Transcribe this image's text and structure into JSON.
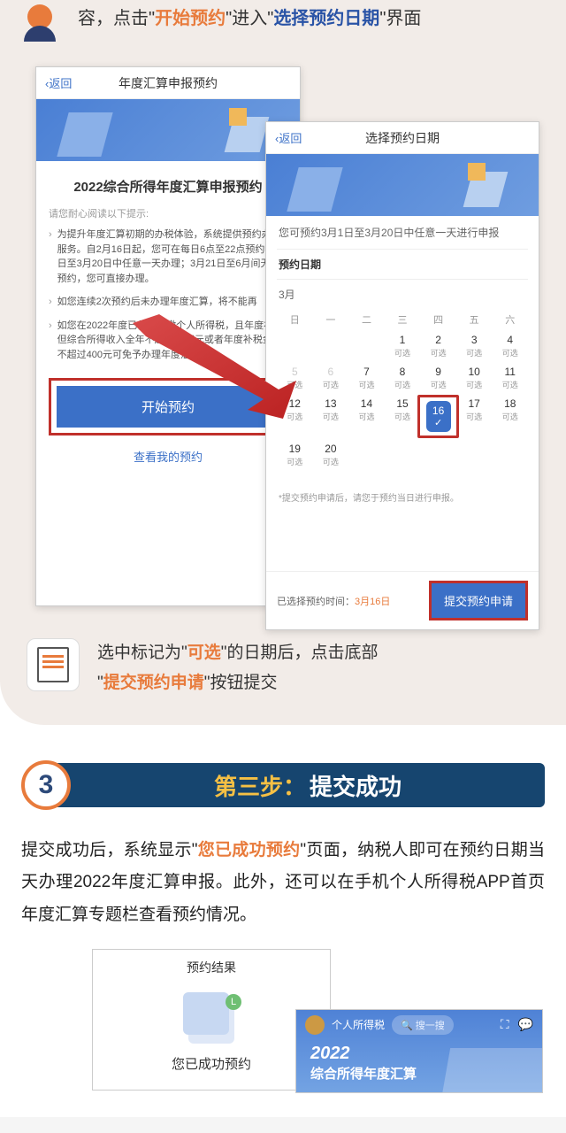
{
  "intro": {
    "pre": "容，点击",
    "q1": "\"",
    "action": "开始预约",
    "mid": "\"进入\"",
    "screen": "选择预约日期",
    "post": "\"界面"
  },
  "left_phone": {
    "back": "返回",
    "title": "年度汇算申报预约",
    "heading": "2022综合所得年度汇算申报预约",
    "tip_label": "请您耐心阅读以下提示:",
    "bullet1": "为提升年度汇算初期的办税体验，系统提供预约办税服务。自2月16日起，您可在每日6点至22点预约3月1日至3月20日中任意一天办理；3月21日至6月间无需预约，您可直接办理。",
    "bullet2": "如您连续2次预约后未办理年度汇算，将不能再",
    "bullet3": "如您在2022年度已依法预缴个人所得税，且年度补税但综合所得收入全年不超过12万元或者年度补税金额不超过400元可免予办理年度汇算。",
    "start_btn": "开始预约",
    "view_my": "查看我的预约"
  },
  "right_phone": {
    "back": "返回",
    "title": "选择预约日期",
    "info": "您可预约3月1日至3月20日中任意一天进行申报",
    "section": "预约日期",
    "month": "3月",
    "weekdays": [
      "日",
      "一",
      "二",
      "三",
      "四",
      "五",
      "六"
    ],
    "status_available": "可选",
    "note": "*提交预约申请后，请您于预约当日进行申报。",
    "selected_label_pre": "已选择预约时间：",
    "selected_date": "3月16日",
    "submit_btn": "提交预约申请",
    "days": [
      [
        "",
        "",
        "",
        "1",
        "2",
        "3",
        "4"
      ],
      [
        "5",
        "6",
        "7",
        "8",
        "9",
        "10",
        "11"
      ],
      [
        "12",
        "13",
        "14",
        "15",
        "16",
        "17",
        "18"
      ],
      [
        "19",
        "20",
        "",
        "",
        "",
        "",
        ""
      ]
    ]
  },
  "instruction": {
    "pre": "选中标记为\"",
    "kw1": "可选",
    "mid1": "\"的日期后，点击底部",
    "line2_pre": "\"",
    "kw2": "提交预约申请",
    "line2_post": "\"按钮提交"
  },
  "step3": {
    "num": "3",
    "title_pre": "第三步：",
    "title_post": "提交成功",
    "desc_pre": "提交成功后，系统显示\"",
    "desc_kw": "您已成功预约",
    "desc_post": "\"页面，纳税人即可在预约日期当天办理2022年度汇算申报。此外，还可以在手机个人所得税APP首页年度汇算专题栏查看预约情况。"
  },
  "result_phone": {
    "title": "预约结果",
    "success": "您已成功预约",
    "badge": "L"
  },
  "app_phone": {
    "name": "个人所得税",
    "search": "搜一搜",
    "year": "2022",
    "sub": "综合所得年度汇算"
  }
}
